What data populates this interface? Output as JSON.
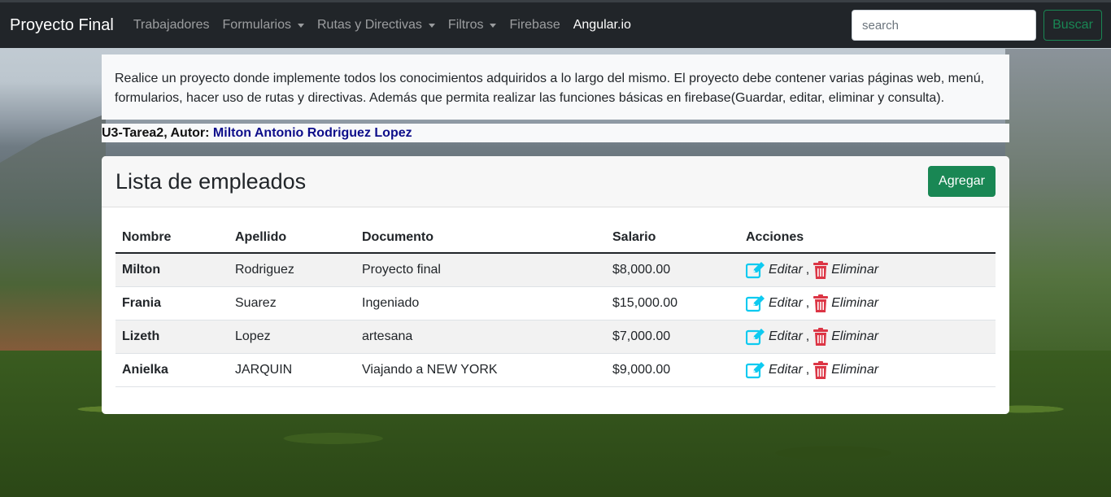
{
  "navbar": {
    "brand": "Proyecto Final",
    "items": [
      {
        "label": "Trabajadores",
        "dropdown": false,
        "active": false
      },
      {
        "label": "Formularios",
        "dropdown": true,
        "active": false
      },
      {
        "label": "Rutas y Directivas",
        "dropdown": true,
        "active": false
      },
      {
        "label": "Filtros",
        "dropdown": true,
        "active": false
      },
      {
        "label": "Firebase",
        "dropdown": false,
        "active": false
      },
      {
        "label": "Angular.io",
        "dropdown": false,
        "active": true
      }
    ],
    "search_placeholder": "search",
    "search_button": "Buscar"
  },
  "intro": {
    "text": "Realice un proyecto donde implemente todos los conocimientos adquiridos a lo largo del mismo. El proyecto debe contener varias páginas web, menú, formularios, hacer uso de rutas y directivas. Además que permita realizar las funciones básicas en firebase(Guardar, editar, eliminar y consulta)."
  },
  "author": {
    "prefix": "U3-Tarea2, Autor: ",
    "name": "Milton Antonio Rodriguez Lopez"
  },
  "card": {
    "title": "Lista de empleados",
    "add_button": "Agregar"
  },
  "table": {
    "headers": [
      "Nombre",
      "Apellido",
      "Documento",
      "Salario",
      "Acciones"
    ],
    "rows": [
      {
        "nombre": "Milton",
        "apellido": "Rodriguez",
        "documento": "Proyecto final",
        "salario": "$8,000.00"
      },
      {
        "nombre": "Frania",
        "apellido": "Suarez",
        "documento": "Ingeniado",
        "salario": "$15,000.00"
      },
      {
        "nombre": "Lizeth",
        "apellido": "Lopez",
        "documento": "artesana",
        "salario": "$7,000.00"
      },
      {
        "nombre": "Anielka",
        "apellido": "JARQUIN",
        "documento": "Viajando a NEW YORK",
        "salario": "$9,000.00"
      }
    ],
    "edit_label": "Editar",
    "separator": ",",
    "delete_label": "Eliminar"
  },
  "colors": {
    "navbar_bg": "#212529",
    "success": "#198754",
    "edit_icon": "#0dcaf0",
    "delete_icon": "#dc3545",
    "author_name": "#0d0d8a"
  },
  "icons": {
    "edit": "edit-icon",
    "delete": "trash-icon",
    "dropdown": "caret-down-icon"
  }
}
